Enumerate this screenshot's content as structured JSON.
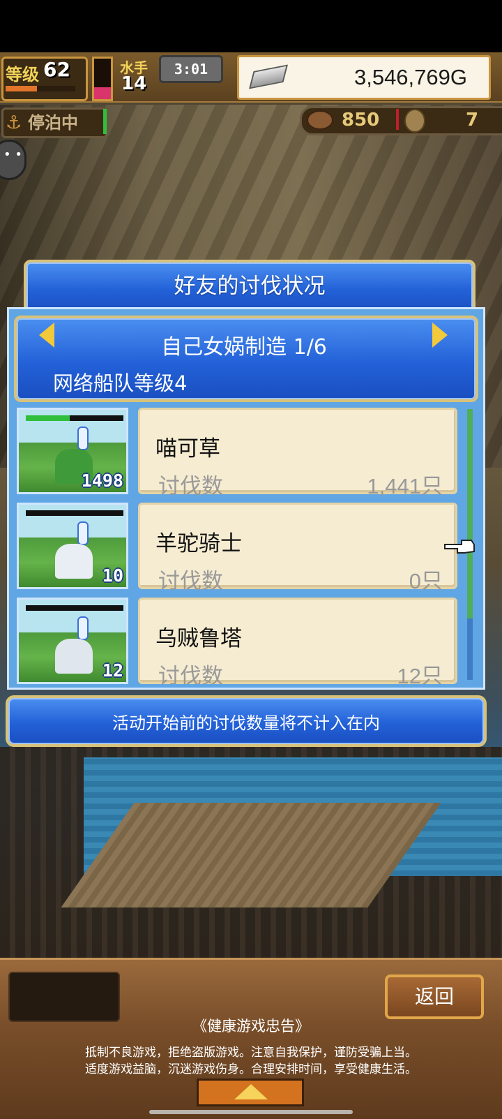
{
  "hud": {
    "level_label": "等级",
    "level_value": "62",
    "level_progress": 0.45,
    "stamina_fill": 0.3,
    "crew_label": "水手",
    "crew_value": "14",
    "time": "3:01",
    "gold": "3,546,769G",
    "status": "停泊中",
    "food": "850",
    "other_resource": "7"
  },
  "dialog": {
    "title": "好友的讨伐状况",
    "header_title": "自己女娲制造 1/6",
    "header_sub": "网络船队等级4",
    "kill_label": "讨伐数",
    "monsters": [
      {
        "name": "喵可草",
        "kills": "1,441只",
        "number": "1498",
        "hp": 0.45,
        "sprite_color": "#3f9a3a"
      },
      {
        "name": "羊驼骑士",
        "kills": "0只",
        "number": "10",
        "hp": 0,
        "sprite_color": "#e8eef4"
      },
      {
        "name": "乌贼鲁塔",
        "kills": "12只",
        "number": "12",
        "hp": 0,
        "sprite_color": "#dfe6ee"
      }
    ],
    "notice": "活动开始前的讨伐数量将不计入在内"
  },
  "bottom": {
    "back_label": "返回",
    "health_title": "《健康游戏忠告》",
    "health_line1": "抵制不良游戏，拒绝盗版游戏。注意自我保护，谨防受骗上当。",
    "health_line2": "适度游戏益脑，沉迷游戏伤身。合理安排时间，享受健康生活。"
  },
  "colors": {
    "dialog_blue": "#2361d8",
    "frame_gold": "#d8c27a",
    "card_bg": "#f6ecd1",
    "arrow_yellow": "#f2c93a"
  }
}
